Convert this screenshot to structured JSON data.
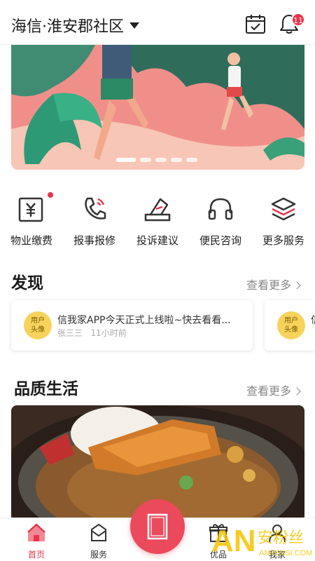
{
  "header": {
    "community_name": "海信·淮安郡社区",
    "notification_count": "11",
    "icons": [
      "calendar-check-icon",
      "bell-icon",
      "chevron-down-icon"
    ]
  },
  "banner": {
    "slide_count": 5,
    "active_slide": 1
  },
  "services": [
    {
      "label": "物业缴费",
      "icon": "yuan-bill-icon",
      "has_dot": true
    },
    {
      "label": "报事报修",
      "icon": "phone-icon",
      "has_dot": false
    },
    {
      "label": "投诉建议",
      "icon": "complaint-icon",
      "has_dot": false
    },
    {
      "label": "便民咨询",
      "icon": "headset-icon",
      "has_dot": false
    },
    {
      "label": "更多服务",
      "icon": "layers-icon",
      "has_dot": false
    }
  ],
  "discover": {
    "title": "发现",
    "more": "查看更多",
    "cards": [
      {
        "avatar": "用户\n头像",
        "title": "信我家APP今天正式上线啦~快去看看...",
        "author": "张三三",
        "time": "11小时前"
      },
      {
        "avatar": "用户\n头像",
        "title": "信",
        "author": "",
        "time": ""
      }
    ]
  },
  "quality": {
    "title": "品质生活",
    "more": "查看更多"
  },
  "tabbar": {
    "tabs": [
      {
        "label": "首页",
        "icon": "home-icon",
        "active": true
      },
      {
        "label": "服务",
        "icon": "service-icon",
        "active": false
      },
      {
        "label": "优品",
        "icon": "gift-icon",
        "active": false
      },
      {
        "label": "我家",
        "icon": "person-icon",
        "active": false
      }
    ],
    "center_icon": "door-icon"
  },
  "watermark": {
    "logo": "AN",
    "brand": "安粉丝",
    "domain": "ANFENSI.COM"
  },
  "colors": {
    "accent": "#e8344a",
    "banner_pink": "#f08f8a",
    "banner_green": "#2f6d5a"
  }
}
